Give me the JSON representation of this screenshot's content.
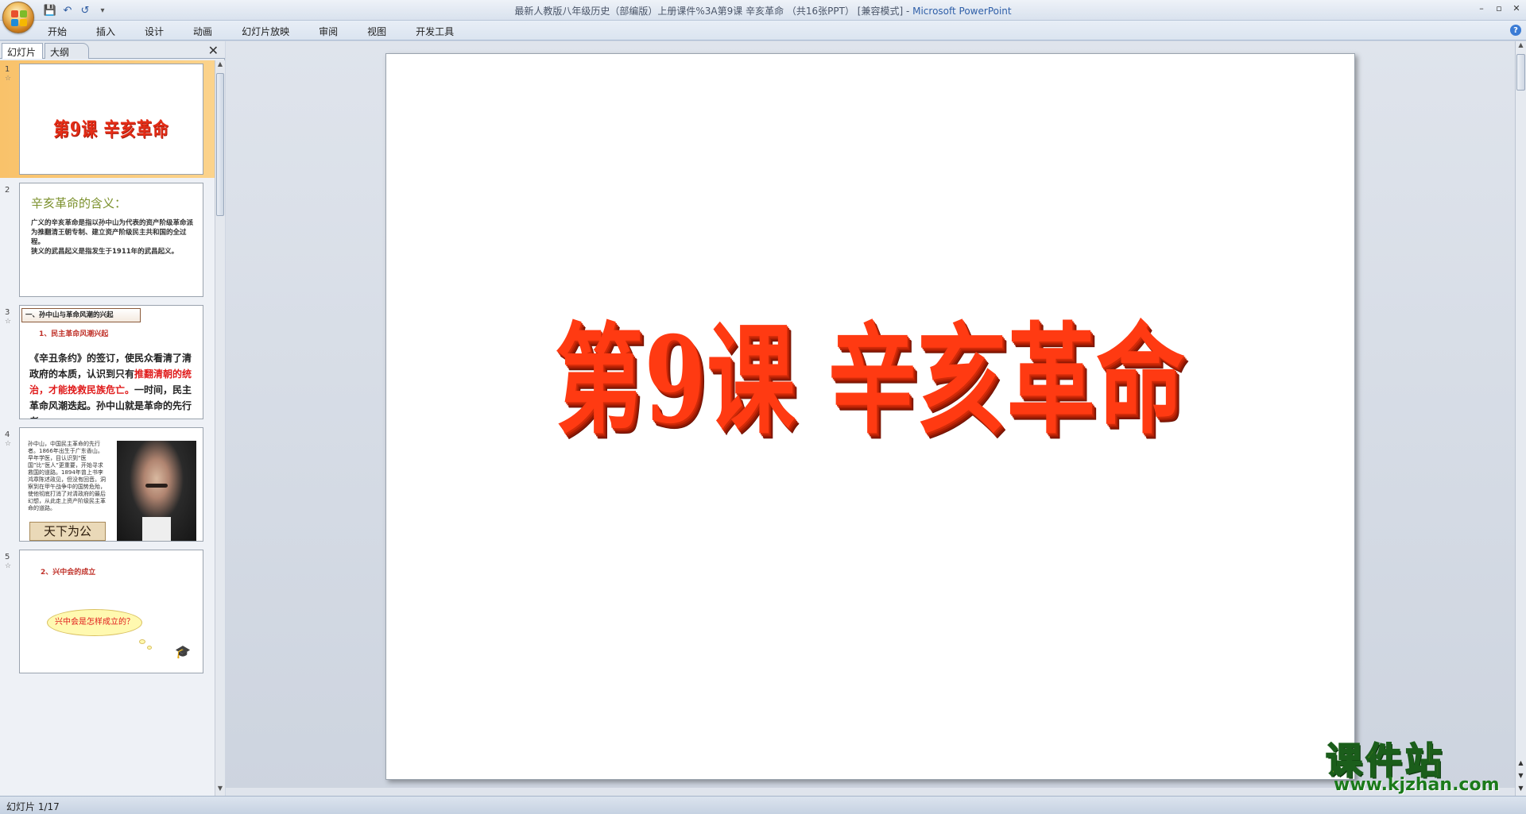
{
  "window": {
    "title": "最新人教版八年级历史（部编版）上册课件%3A第9课   辛亥革命 （共16张PPT）  [兼容模式] - ",
    "app_name": "Microsoft PowerPoint",
    "controls": [
      "–",
      "▫",
      "✕"
    ]
  },
  "qat": {
    "save_icon": "💾",
    "undo_icon": "↶",
    "redo_icon": "↺",
    "more_icon": "▾"
  },
  "ribbon": {
    "tabs": [
      "开始",
      "插入",
      "设计",
      "动画",
      "幻灯片放映",
      "审阅",
      "视图",
      "开发工具"
    ],
    "help": "?"
  },
  "panel": {
    "tab_slides": "幻灯片",
    "tab_outline": "大纲",
    "close": "✕"
  },
  "thumbnails": [
    {
      "num": "1",
      "title": "第9课   辛亥革命"
    },
    {
      "num": "2",
      "title": "辛亥革命的含义：",
      "body": "广义的辛亥革命是指以孙中山为代表的资产阶级革命派为推翻清王朝专制、建立资产阶级民主共和国的全过程。\n狭义的武昌起义是指发生于1911年的武昌起义。"
    },
    {
      "num": "3",
      "banner": "一、孙中山与革命风潮的兴起",
      "subtitle": "1、民主革命风潮兴起",
      "body_a": "《辛丑条约》的签订，使民众看清了清政府的本质，认识到只有",
      "body_red": "推翻清朝的统治，才能挽救民族危亡。",
      "body_b": "一时间，民主革命风潮迭起。孙中山就是革命的先行者。"
    },
    {
      "num": "4",
      "body": "孙中山，中国民主革命的先行者。1866年出生于广东香山。早年学医，目认识到“医国”比“医人”更重要，开始寻求救国的道路。1894年曾上书李鸿章陈述政见，但没有回音。洞察到在甲午战争中的国势危殆，使他彻底打消了对清政府的最后幻想，从此走上资产阶级民主革命的道路。",
      "calligraphy": "天下为公"
    },
    {
      "num": "5",
      "subtitle": "2、兴中会的成立",
      "bubble": "兴中会是怎样成立的？"
    }
  ],
  "slide": {
    "title": "第9课   辛亥革命"
  },
  "status": {
    "text": "幻灯片 1/17"
  },
  "watermark": {
    "cn": "课件站",
    "url": "www.kjzhan.com"
  }
}
